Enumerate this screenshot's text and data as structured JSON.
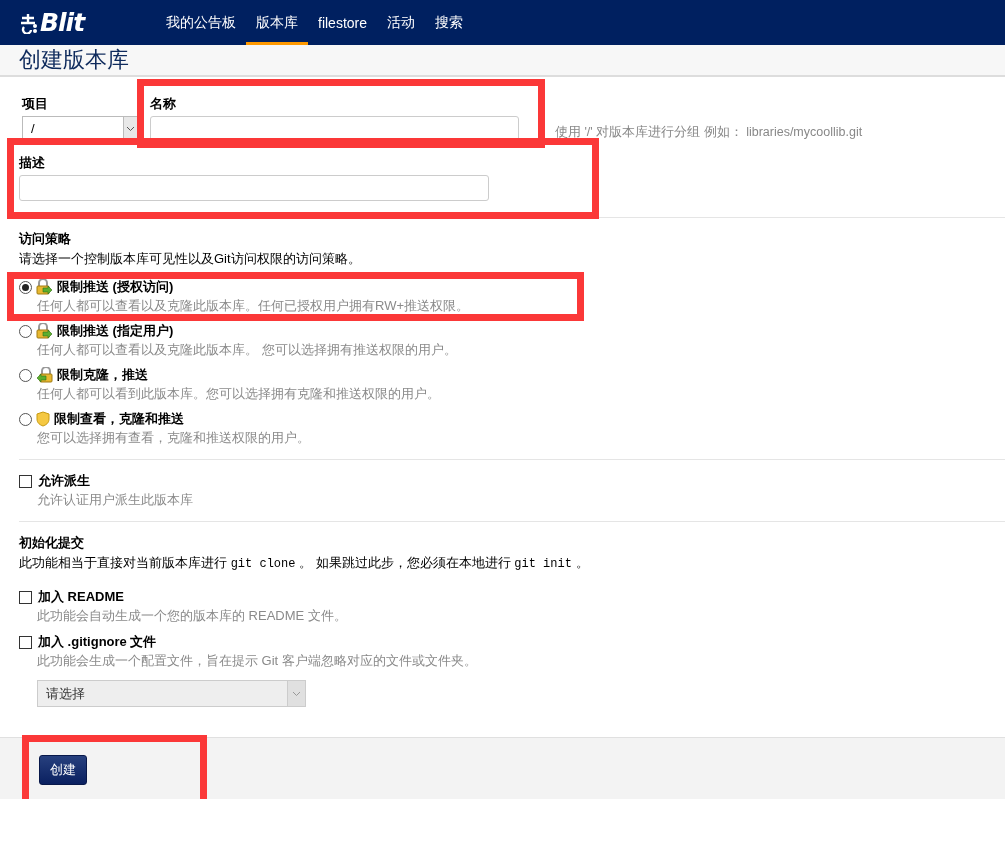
{
  "header": {
    "logo": "Blit",
    "nav": [
      {
        "label": "我的公告板",
        "selected": false
      },
      {
        "label": "版本库",
        "selected": true
      },
      {
        "label": "filestore",
        "selected": false
      },
      {
        "label": "活动",
        "selected": false
      },
      {
        "label": "搜索",
        "selected": false
      }
    ]
  },
  "page_title": "创建版本库",
  "project": {
    "label": "项目",
    "value": "/"
  },
  "name": {
    "label": "名称",
    "highlighted": true
  },
  "name_hint": "使用 '/' 对版本库进行分组 例如： libraries/mycoollib.git",
  "description": {
    "label": "描述",
    "highlighted": true
  },
  "access_policy": {
    "title": "访问策略",
    "description": "请选择一个控制版本库可见性以及Git访问权限的访问策略。",
    "options": [
      {
        "kind": "push",
        "label": "限制推送 (授权访问)",
        "description": "任何人都可以查看以及克隆此版本库。任何已授权用户拥有RW+推送权限。",
        "selected": true,
        "highlighted": true
      },
      {
        "kind": "push",
        "label": "限制推送 (指定用户)",
        "description": "任何人都可以查看以及克隆此版本库。 您可以选择拥有推送权限的用户。",
        "selected": false,
        "highlighted": false
      },
      {
        "kind": "clone",
        "label": "限制克隆，推送",
        "description": "任何人都可以看到此版本库。您可以选择拥有克隆和推送权限的用户。",
        "selected": false,
        "highlighted": false
      },
      {
        "kind": "shield",
        "label": "限制查看，克隆和推送",
        "description": "您可以选择拥有查看，克隆和推送权限的用户。",
        "selected": false,
        "highlighted": false
      }
    ]
  },
  "allow_fork": {
    "label": "允许派生",
    "description": "允许认证用户派生此版本库",
    "checked": false
  },
  "initial_commit": {
    "title": "初始化提交",
    "description": [
      {
        "kind": "text",
        "text": "此功能相当于直接对当前版本库进行 "
      },
      {
        "kind": "code",
        "text": "git clone"
      },
      {
        "kind": "text",
        "text": " 。 如果跳过此步，您必须在本地进行 "
      },
      {
        "kind": "code",
        "text": "git init"
      },
      {
        "kind": "text",
        "text": " 。"
      }
    ],
    "options": [
      {
        "label": "加入 README",
        "description": "此功能会自动生成一个您的版本库的 README 文件。",
        "checked": false
      },
      {
        "label": "加入 .gitignore 文件",
        "description": "此功能会生成一个配置文件，旨在提示 Git 客户端忽略对应的文件或文件夹。",
        "checked": false,
        "select": "请选择"
      }
    ]
  },
  "footer": {
    "button": "创建",
    "highlighted": true
  }
}
